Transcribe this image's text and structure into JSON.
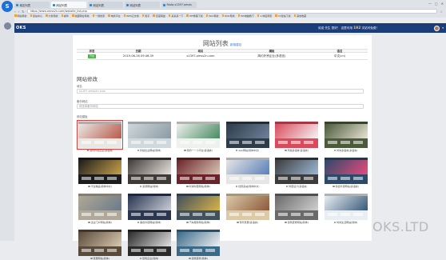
{
  "browser": {
    "tabs": [
      {
        "label": "域名列表"
      },
      {
        "label": "网站列表",
        "active": true
      },
      {
        "label": "网站列表"
      },
      {
        "label": "网站列表"
      },
      {
        "label": "Fasta.s1397.omsis"
      }
    ],
    "url": "https://www.omss2n.com/website_list.php",
    "bookmarks": [
      "网站导航",
      "建站中心",
      "大象导航",
      "邮件",
      "收藏网址导航",
      "一键搜索",
      "电商平台",
      "WPS云文档",
      "知乎",
      "百度网盘",
      "某某某一下",
      "IHF教程下载",
      "Wiki导航",
      "WiKi导航",
      "WS电脑教下",
      "1.域名网页",
      "Y2建站下载",
      "其他收藏"
    ]
  },
  "app": {
    "brand": "OKS",
    "notice_prefix": "欢迎 先生 您好！ 这里可用",
    "notice_highlight": "192",
    "notice_suffix": "次站可免费！"
  },
  "page": {
    "title": "网站列表",
    "title_link": "新增建站",
    "table": {
      "headers": [
        "状态",
        "日期",
        "域名",
        "模板",
        "语言"
      ],
      "rows": [
        {
          "status": "开启",
          "date": "2019-06-26 09:46:39",
          "domain": "s1397.omss2n.com",
          "template": "简约外贸企业(多语言)",
          "language": "中文(cn)"
        }
      ]
    },
    "section_title": "网站修改",
    "domain_label": "域名",
    "domain_placeholder": "s1397.omss2n.com",
    "backup_label": "备份网站",
    "backup_placeholder": "请选择备份网站",
    "template_label": "网站模板",
    "templates": [
      {
        "caption": "简约外贸企业(多语言)",
        "selected": true,
        "hero": "#e9e7e4",
        "accent": "#b85a4a"
      },
      {
        "caption": "科技企业网站(简体)",
        "hero": "#cfd8dc",
        "accent": "#8a9aa3"
      },
      {
        "caption": "简约一一小平台(多语言)",
        "hero": "#eef1ee",
        "accent": "#4a8a62"
      },
      {
        "caption": "app网站(简体中文)",
        "hero": "#2d3b4a",
        "accent": "#6d8299"
      },
      {
        "caption": "风格多语言(多语言)",
        "hero": "#d94b5c",
        "accent": "#f4f4f4"
      },
      {
        "caption": "时尚多语言(多语言)",
        "hero": "#4a5a3a",
        "accent": "#e7e2d2"
      },
      {
        "caption": "平台精品(简体中文)",
        "hero": "#1c1c1c",
        "accent": "#c8a04a"
      },
      {
        "caption": "蓝调网站(简体)",
        "hero": "#3f3a38",
        "accent": "#e6e1dc"
      },
      {
        "caption": "时尚时装网站(简体)",
        "hero": "#6a2328",
        "accent": "#d8c4b4"
      },
      {
        "caption": "创意多站(简体中文)",
        "hero": "#e6e6e6",
        "accent": "#5a7fb8"
      },
      {
        "caption": "时装设计(多语言)",
        "hero": "#3c3c3c",
        "accent": "#9bb7d4"
      },
      {
        "caption": "综合外贸网站(多语言)",
        "hero": "#2c4a6a",
        "accent": "#e64a7b"
      },
      {
        "caption": "企业门户网站(简体)",
        "hero": "#b0a898",
        "accent": "#6a7a88"
      },
      {
        "caption": "美妆外贸网站(简体)",
        "hero": "#2a3650",
        "accent": "#c8cdd6"
      },
      {
        "caption": "汽车服务网站(简体)",
        "hero": "#40505c",
        "accent": "#d8b24a"
      },
      {
        "caption": "现代家居(多语言)",
        "hero": "#dcc9a8",
        "accent": "#8b5a3a"
      },
      {
        "caption": "建筑装修网站(简体)",
        "hero": "#6a6a6a",
        "accent": "#cfcfcf"
      },
      {
        "caption": "时尚生活网站(简体)",
        "hero": "#e8eef2",
        "accent": "#3a5a7a"
      },
      {
        "caption": "家居网站(简体)",
        "hero": "#5a4a3a",
        "accent": "#d8c8b0"
      },
      {
        "caption": "建筑企业(简体)",
        "hero": "#2a2a2a",
        "accent": "#e0e0e0"
      },
      {
        "caption": "建筑装修(简体)",
        "hero": "#3a6a8a",
        "accent": "#f0f0f0"
      }
    ]
  },
  "watermark": "OKS.LTD"
}
